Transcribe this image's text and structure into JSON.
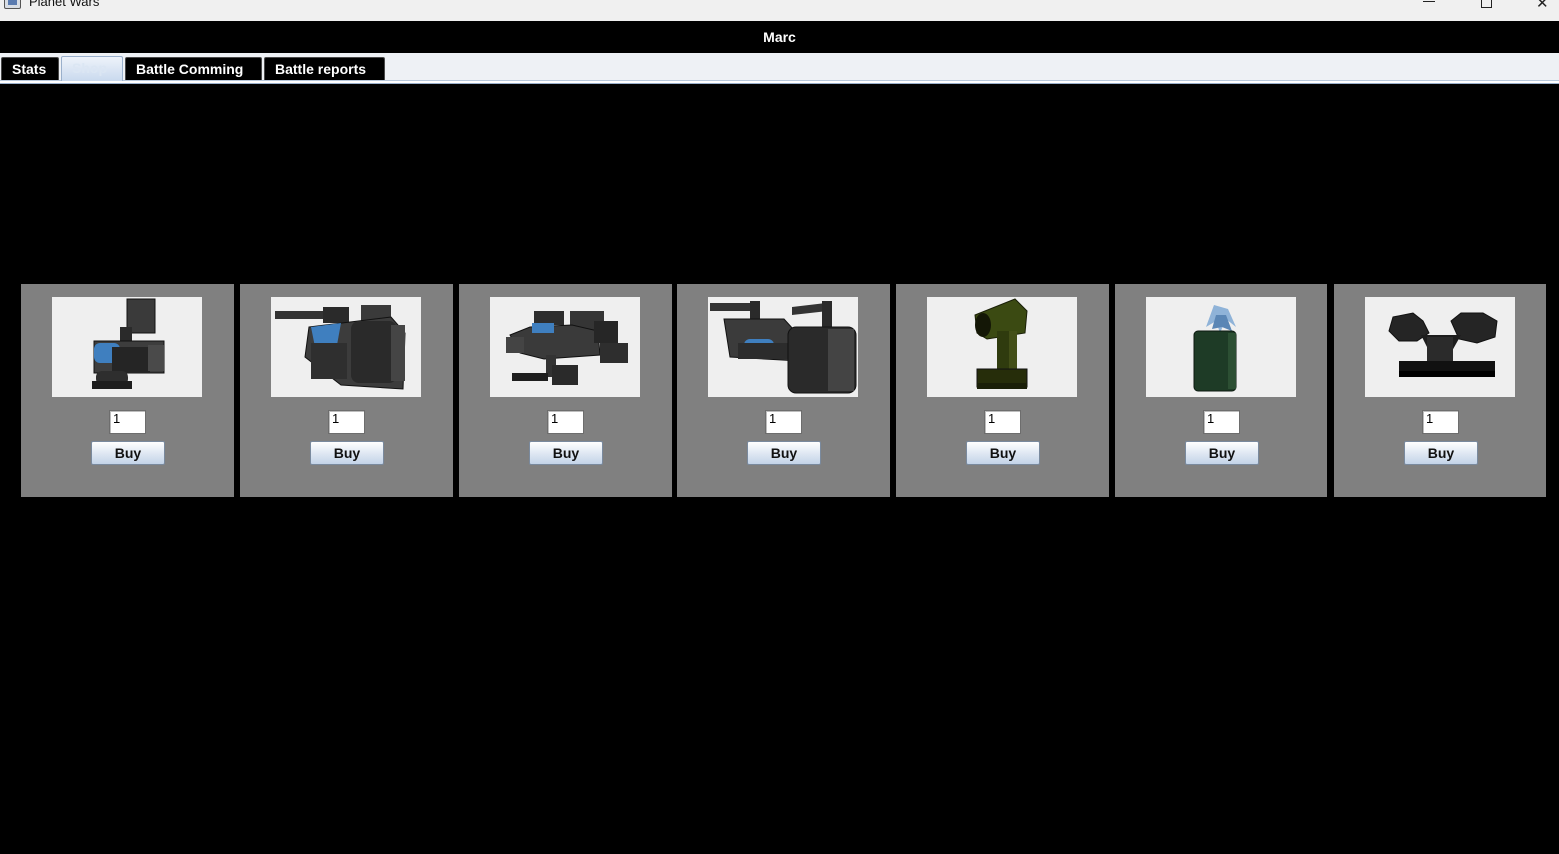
{
  "window": {
    "title": "Planet Wars",
    "controls": [
      "minimize-icon",
      "maximize-icon",
      "close-icon"
    ]
  },
  "header": {
    "player_name": "Marc"
  },
  "tabs": [
    {
      "label": "Stats",
      "selected": false
    },
    {
      "label": "Shop",
      "selected": true
    },
    {
      "label": "Battle Comming",
      "selected": false
    },
    {
      "label": "Battle reports",
      "selected": false
    }
  ],
  "shop": {
    "items": [
      {
        "icon": "walker-turret-unit-icon",
        "quantity": "1",
        "buy_label": "Buy"
      },
      {
        "icon": "heavy-tank-unit-icon",
        "quantity": "1",
        "buy_label": "Buy"
      },
      {
        "icon": "spider-mech-unit-icon",
        "quantity": "1",
        "buy_label": "Buy"
      },
      {
        "icon": "twin-cannon-tank-icon",
        "quantity": "1",
        "buy_label": "Buy"
      },
      {
        "icon": "cannon-tower-icon",
        "quantity": "1",
        "buy_label": "Buy"
      },
      {
        "icon": "crystal-generator-icon",
        "quantity": "1",
        "buy_label": "Buy"
      },
      {
        "icon": "twin-turret-base-icon",
        "quantity": "1",
        "buy_label": "Buy"
      }
    ]
  },
  "colors": {
    "background": "#000000",
    "card": "#808080",
    "preview": "#efefef",
    "accent_blue": "#3f7fbf",
    "tower_green": "#3b4a12",
    "crystal_green": "#1e3b26"
  }
}
